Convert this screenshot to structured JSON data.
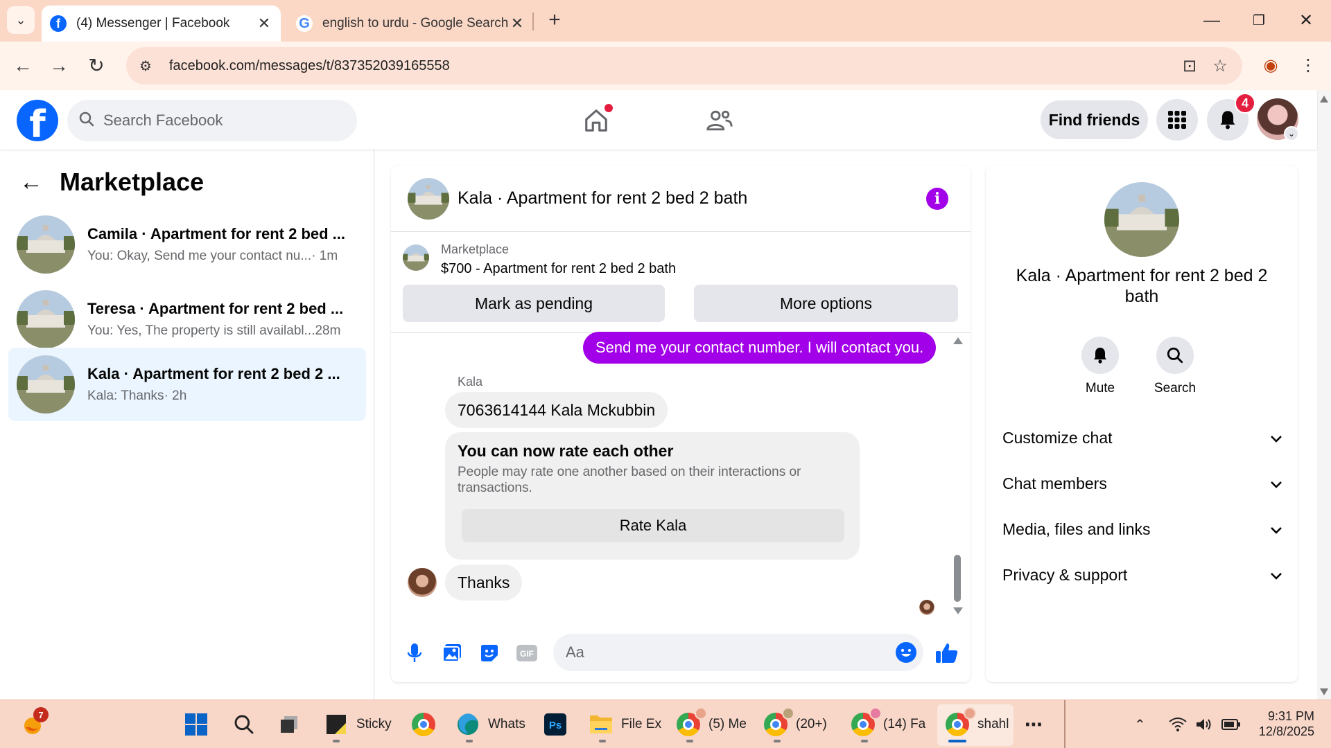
{
  "browser": {
    "tabs": [
      {
        "title": "(4) Messenger | Facebook",
        "active": true
      },
      {
        "title": "english to urdu - Google Search",
        "active": false
      }
    ],
    "url": "facebook.com/messages/t/837352039165558"
  },
  "header": {
    "search_placeholder": "Search Facebook",
    "find_friends": "Find friends",
    "notification_count": "4"
  },
  "sidebar": {
    "title": "Marketplace",
    "conversations": [
      {
        "name": "Camila · Apartment for rent 2 bed ...",
        "snippet": "You: Okay, Send me your contact nu...",
        "time": " · 1m",
        "selected": false
      },
      {
        "name": "Teresa · Apartment for rent 2 bed ...",
        "snippet": "You: Yes, The property is still availabl...",
        "time": " 28m",
        "selected": false
      },
      {
        "name": "Kala · Apartment for rent 2 bed 2 ...",
        "snippet": "Kala: Thanks",
        "time": " · 2h",
        "selected": true
      }
    ]
  },
  "chat": {
    "title": "Kala · Apartment for rent 2 bed 2 bath",
    "listing": {
      "label": "Marketplace",
      "detail": "$700 - Apartment for rent 2 bed 2 bath",
      "mark_pending": "Mark as pending",
      "more_options": "More options"
    },
    "messages": {
      "outgoing": "Send me your contact number. I will contact you.",
      "sender": "Kala",
      "incoming_1": "7063614144 Kala Mckubbin",
      "rate_title": "You can now rate each other",
      "rate_text": "People may rate one another based on their interactions or transactions.",
      "rate_button": "Rate Kala",
      "incoming_2": "Thanks"
    },
    "composer_placeholder": "Aa"
  },
  "details": {
    "name": "Kala · Apartment for rent 2 bed 2 bath",
    "actions": [
      {
        "label": "Mute"
      },
      {
        "label": "Search"
      }
    ],
    "sections": [
      {
        "label": "Customize chat"
      },
      {
        "label": "Chat members"
      },
      {
        "label": "Media, files and links"
      },
      {
        "label": "Privacy & support"
      }
    ]
  },
  "taskbar": {
    "weather_badge": "7",
    "items": [
      {
        "label": "Sticky"
      },
      {
        "label": "Whats"
      },
      {
        "label": "File Ex"
      },
      {
        "label": "(5) Me"
      },
      {
        "label": "(20+)"
      },
      {
        "label": "(14) Fa"
      },
      {
        "label": "shahl"
      }
    ],
    "time": "9:31 PM",
    "date": "12/8/2025"
  },
  "colors": {
    "facebook_blue": "#0866ff",
    "messenger_purple": "#a200e8",
    "notification_red": "#e41e3f",
    "selected_row": "#ebf5ff"
  }
}
